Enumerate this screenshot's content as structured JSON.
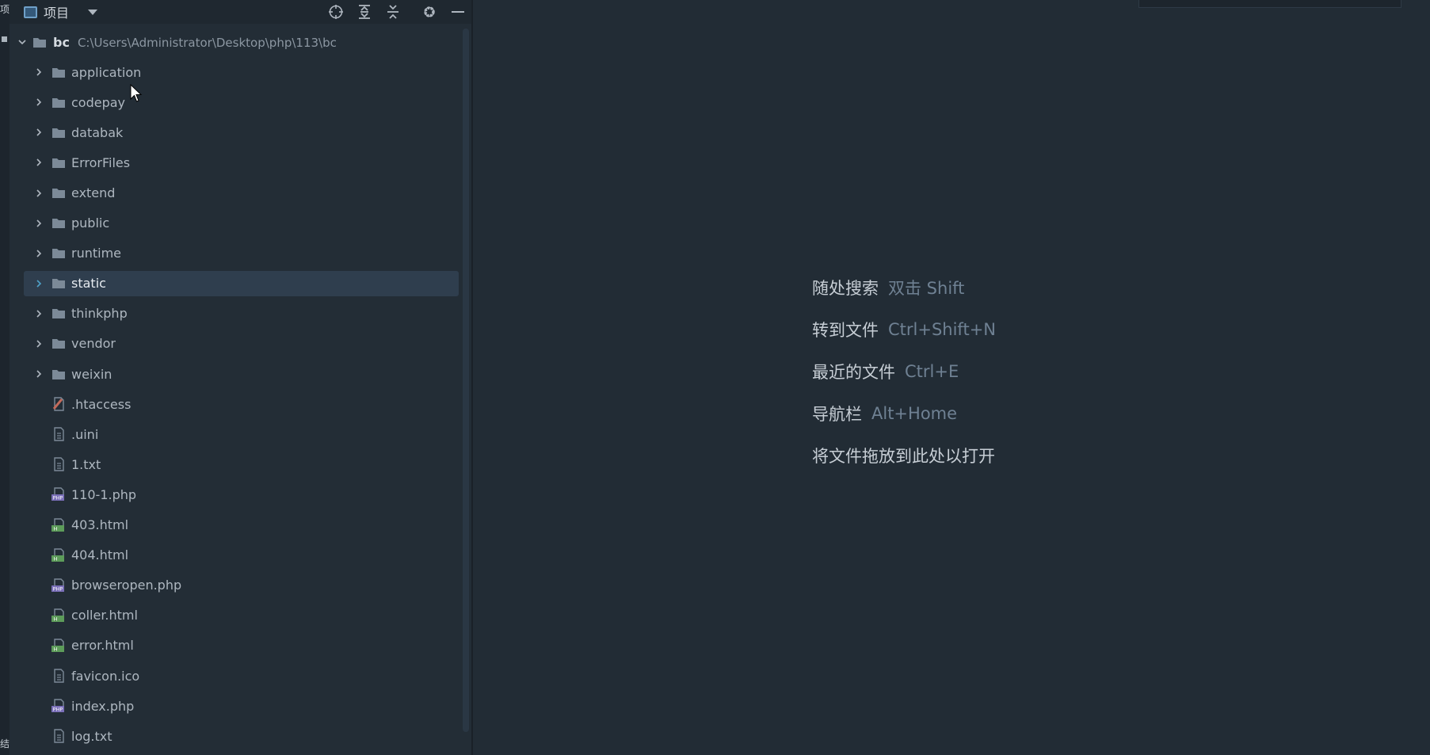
{
  "sidebar_strip": {
    "top_label": "项",
    "bottom_label": "结"
  },
  "header": {
    "title": "项目",
    "icons": [
      "locate-icon",
      "expand-all-icon",
      "collapse-all-icon",
      "gear-icon",
      "minimize-icon"
    ]
  },
  "tree": {
    "root": {
      "name": "bc",
      "path": "C:\\Users\\Administrator\\Desktop\\php\\113\\bc"
    },
    "items": [
      {
        "name": "application",
        "kind": "folder"
      },
      {
        "name": "codepay",
        "kind": "folder"
      },
      {
        "name": "databak",
        "kind": "folder"
      },
      {
        "name": "ErrorFiles",
        "kind": "folder"
      },
      {
        "name": "extend",
        "kind": "folder"
      },
      {
        "name": "public",
        "kind": "folder"
      },
      {
        "name": "runtime",
        "kind": "folder"
      },
      {
        "name": "static",
        "kind": "folder",
        "selected": true
      },
      {
        "name": "thinkphp",
        "kind": "folder"
      },
      {
        "name": "vendor",
        "kind": "folder"
      },
      {
        "name": "weixin",
        "kind": "folder"
      },
      {
        "name": ".htaccess",
        "kind": "config"
      },
      {
        "name": ".uini",
        "kind": "text"
      },
      {
        "name": "1.txt",
        "kind": "text"
      },
      {
        "name": "110-1.php",
        "kind": "php"
      },
      {
        "name": "403.html",
        "kind": "html"
      },
      {
        "name": "404.html",
        "kind": "html"
      },
      {
        "name": "browseropen.php",
        "kind": "php"
      },
      {
        "name": "coller.html",
        "kind": "html"
      },
      {
        "name": "error.html",
        "kind": "html"
      },
      {
        "name": "favicon.ico",
        "kind": "text"
      },
      {
        "name": "index.php",
        "kind": "php"
      },
      {
        "name": "log.txt",
        "kind": "text"
      }
    ]
  },
  "editor_hints": [
    {
      "label": "随处搜索",
      "shortcut": "双击 Shift"
    },
    {
      "label": "转到文件",
      "shortcut": "Ctrl+Shift+N"
    },
    {
      "label": "最近的文件",
      "shortcut": "Ctrl+E"
    },
    {
      "label": "导航栏",
      "shortcut": "Alt+Home"
    },
    {
      "label": "将文件拖放到此处以打开",
      "shortcut": ""
    }
  ],
  "colors": {
    "background": "#222c35",
    "panel": "#232d36",
    "selection": "#2f3e4e",
    "folder": "#7c8a98",
    "php_badge": "#7a6fb8",
    "html_badge": "#5d9c5a",
    "htaccess_badge": "#c26a5a"
  }
}
